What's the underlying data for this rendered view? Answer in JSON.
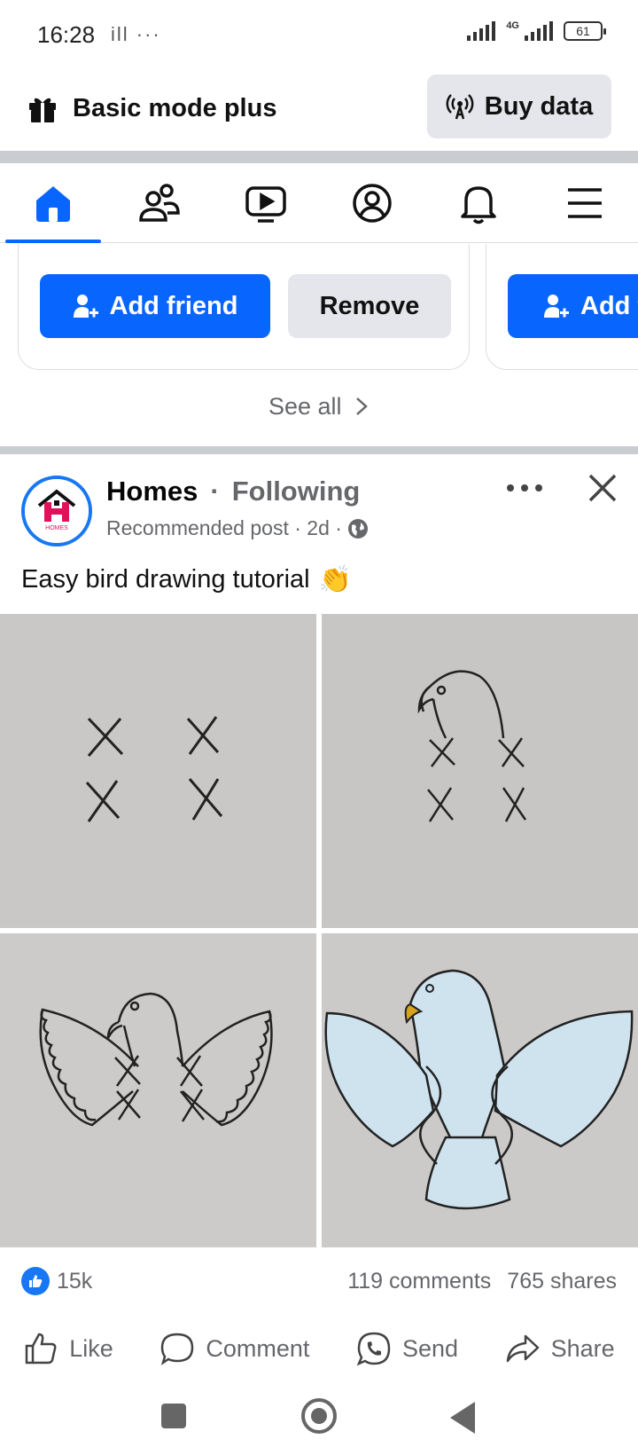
{
  "status_bar": {
    "time": "16:28",
    "left_icons": "ill ···",
    "network": "4G",
    "battery": "61"
  },
  "banner": {
    "title": "Basic mode plus",
    "buy_label": "Buy data"
  },
  "nav": {
    "items": [
      "home-icon",
      "friends-icon",
      "video-icon",
      "profile-icon",
      "notifications-icon",
      "menu-icon"
    ],
    "active": "home"
  },
  "suggestions": {
    "add_friend_label": "Add friend",
    "remove_label": "Remove",
    "partial_add_label": "Add f",
    "see_all_label": "See all"
  },
  "post": {
    "author": "Homes",
    "separator": "·",
    "following_label": "Following",
    "meta": "Recommended post · 2d ·",
    "avatar_text": "HOMES",
    "text": "Easy bird drawing tutorial",
    "emoji": "👏"
  },
  "reactions": {
    "likes": "15k",
    "comments": "119 comments",
    "shares": "765 shares"
  },
  "actions": {
    "like": "Like",
    "comment": "Comment",
    "send": "Send",
    "share": "Share"
  },
  "colors": {
    "brand_blue": "#0866ff",
    "grey_button": "#e4e6eb",
    "muted_text": "#65676b"
  }
}
